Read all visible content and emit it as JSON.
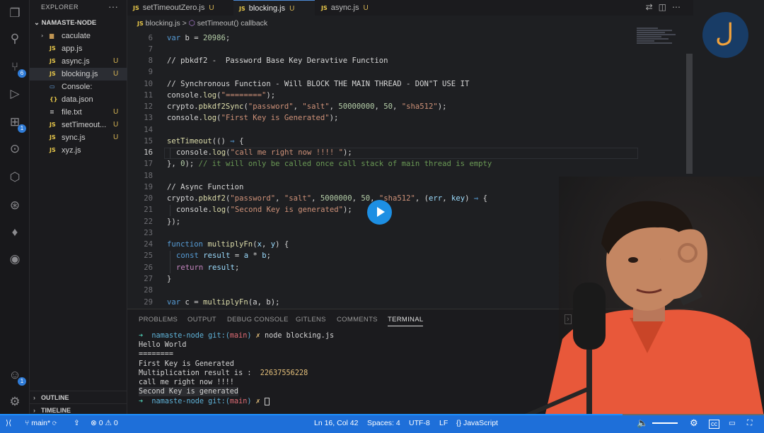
{
  "sidebar": {
    "title": "EXPLORER",
    "more": "···",
    "folder": "NAMASTE-NODE",
    "items": [
      {
        "icon": "folder",
        "label": "caculate",
        "status": ""
      },
      {
        "icon": "JS",
        "label": "app.js",
        "status": ""
      },
      {
        "icon": "JS",
        "label": "async.js",
        "status": "U"
      },
      {
        "icon": "JS",
        "label": "blocking.js",
        "status": "U"
      },
      {
        "icon": "JS",
        "label": "Console:",
        "status": ""
      },
      {
        "icon": "{}",
        "label": "data.json",
        "status": ""
      },
      {
        "icon": "≡",
        "label": "file.txt",
        "status": "U"
      },
      {
        "icon": "JS",
        "label": "setTimeout...",
        "status": "U"
      },
      {
        "icon": "JS",
        "label": "sync.js",
        "status": "U"
      },
      {
        "icon": "JS",
        "label": "xyz.js",
        "status": ""
      }
    ],
    "outline": "OUTLINE",
    "timeline": "TIMELINE"
  },
  "activity": {
    "scm_badge": "6",
    "ext_badge": "1",
    "account_badge": "1"
  },
  "tabs": [
    {
      "icon": "JS",
      "label": "setTimeoutZero.js",
      "status": "U"
    },
    {
      "icon": "JS",
      "label": "blocking.js",
      "status": "U"
    },
    {
      "icon": "JS",
      "label": "async.js",
      "status": "U"
    }
  ],
  "breadcrumb": {
    "file": "blocking.js",
    "sep": ">",
    "symbol": "setTimeout() callback"
  },
  "editor": {
    "lines": [
      {
        "n": "6"
      },
      {
        "n": "7"
      },
      {
        "n": "8"
      },
      {
        "n": "9"
      },
      {
        "n": "10"
      },
      {
        "n": "11"
      },
      {
        "n": "12"
      },
      {
        "n": "13"
      },
      {
        "n": "14"
      },
      {
        "n": "15"
      },
      {
        "n": "16"
      },
      {
        "n": "17"
      },
      {
        "n": "18"
      },
      {
        "n": "19"
      },
      {
        "n": "20"
      },
      {
        "n": "21"
      },
      {
        "n": "22"
      },
      {
        "n": "23"
      },
      {
        "n": "24"
      },
      {
        "n": "25"
      },
      {
        "n": "26"
      },
      {
        "n": "27"
      },
      {
        "n": "28"
      },
      {
        "n": "29"
      }
    ],
    "code": {
      "l6_a": "var",
      "l6_b": " b = ",
      "l6_c": "20986",
      "l6_d": ";",
      "l8": "// pbkdf2 -  Password Base Key Deravtive Function",
      "l10": "// Synchronous Function - Will BLOCK THE MAIN THREAD - DON\"T USE IT",
      "l11_a": "console.",
      "l11_b": "log",
      "l11_c": "(",
      "l11_d": "\"========\"",
      "l11_e": ");",
      "l12_a": "crypto.",
      "l12_b": "pbkdf2Sync",
      "l12_c": "(",
      "l12_d": "\"password\"",
      "l12_e": ", ",
      "l12_f": "\"salt\"",
      "l12_g": ", ",
      "l12_h": "50000000",
      "l12_i": ", ",
      "l12_j": "50",
      "l12_k": ", ",
      "l12_l": "\"sha512\"",
      "l12_m": ");",
      "l13_a": "console.",
      "l13_b": "log",
      "l13_c": "(",
      "l13_d": "\"First Key is Generated\"",
      "l13_e": ");",
      "l15_a": "setTimeout",
      "l15_b": "(() ",
      "l15_c": "⇒",
      "l15_d": " {",
      "l16_a": "console.",
      "l16_b": "log",
      "l16_c": "(",
      "l16_d": "\"call me right now !!!! \"",
      "l16_e": ");",
      "l17_a": "}, ",
      "l17_b": "0",
      "l17_c": "); ",
      "l17_d": "// it will only be called once call stack of main thread is empty",
      "l19": "// Async Function",
      "l20_a": "crypto.",
      "l20_b": "pbkdf2",
      "l20_c": "(",
      "l20_d": "\"password\"",
      "l20_e": ", ",
      "l20_f": "\"salt\"",
      "l20_g": ", ",
      "l20_h": "5000000",
      "l20_i": ", ",
      "l20_j": "50",
      "l20_k": ", ",
      "l20_l": "\"sha512\"",
      "l20_m": ", (",
      "l20_n": "err",
      "l20_o": ", ",
      "l20_p": "key",
      "l20_q": ") ",
      "l20_r": "⇒",
      "l20_s": " {",
      "l21_a": "console.",
      "l21_b": "log",
      "l21_c": "(",
      "l21_d": "\"Second Key is generated\"",
      "l21_e": ");",
      "l22": "});",
      "l24_a": "function",
      "l24_b": " multiplyFn",
      "l24_c": "(",
      "l24_d": "x",
      "l24_e": ", ",
      "l24_f": "y",
      "l24_g": ") {",
      "l25_a": "const",
      "l25_b": " result",
      "l25_c": " = ",
      "l25_d": "a",
      "l25_e": " * ",
      "l25_f": "b",
      "l25_g": ";",
      "l26_a": "return",
      "l26_b": " result",
      "l26_c": ";",
      "l27": "}",
      "l29_a": "var",
      "l29_b": " c = ",
      "l29_c": "multiplyFn",
      "l29_d": "(a, b);"
    }
  },
  "panel": {
    "tabs": [
      "PROBLEMS",
      "OUTPUT",
      "DEBUG CONSOLE",
      "GITLENS",
      "COMMENTS",
      "TERMINAL"
    ],
    "active_tab": "TERMINAL",
    "prompt": {
      "arrow": "➜",
      "dir": "namaste-node",
      "git": "git:(",
      "branch": "main",
      "close": ")",
      "x": "✗",
      "cmd": "node blocking.js"
    },
    "output": [
      "Hello World",
      "========",
      "First Key is Generated",
      "Multiplication result is :  ",
      "call me right now !!!!",
      "Second Key is generated"
    ],
    "mult_value": "22637556228"
  },
  "status": {
    "branch": "main*",
    "errors": "0",
    "warnings": "0",
    "position": "Ln 16, Col 42",
    "spaces": "Spaces: 4",
    "encoding": "UTF-8",
    "eol": "LF",
    "language": "JavaScript"
  },
  "colors": {
    "accent": "#1e6fd9",
    "play": "#1d8fe3",
    "shirt": "#e8583a"
  }
}
